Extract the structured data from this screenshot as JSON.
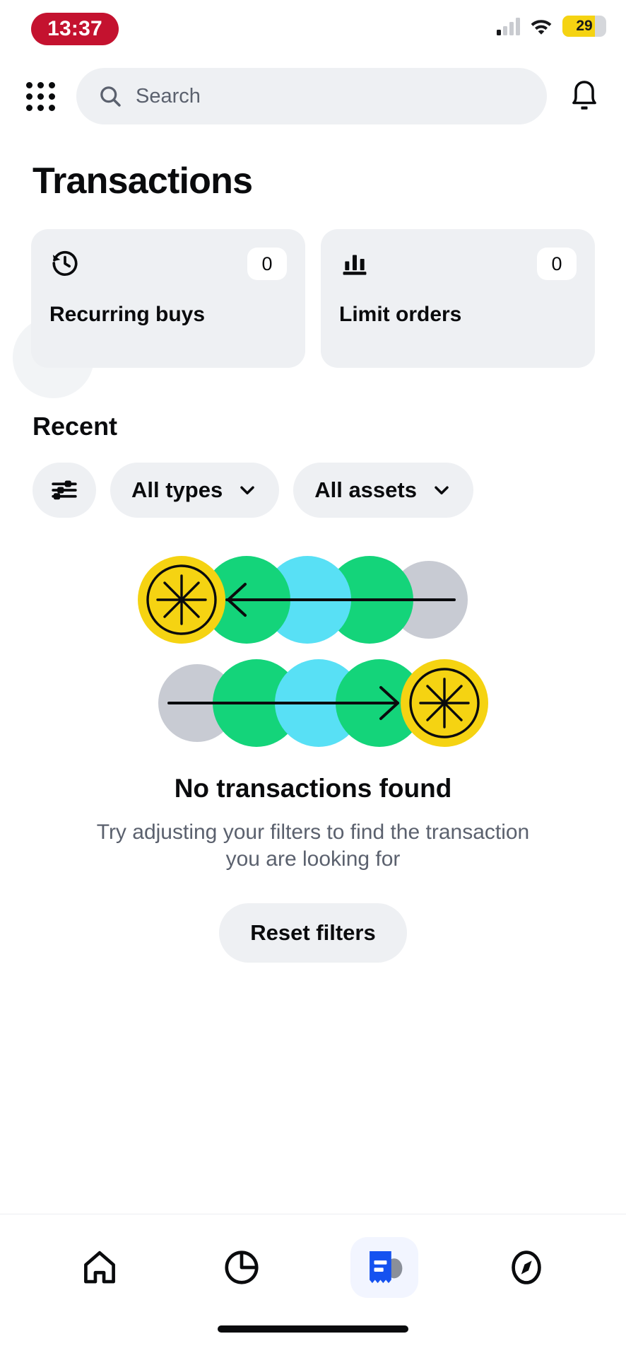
{
  "status_bar": {
    "time": "13:37",
    "time_pill_color": "#c4122f",
    "battery_level": "29",
    "battery_fill_color": "#f5d312",
    "signal_icon": "cellular-signal-icon",
    "wifi_icon": "wifi-icon"
  },
  "app_bar": {
    "grid_icon": "app-grid-icon",
    "search_placeholder": "Search",
    "search_icon": "search-icon",
    "notification_icon": "bell-icon"
  },
  "page": {
    "title": "Transactions",
    "section_title": "Recent"
  },
  "cards": [
    {
      "icon": "history-clock-icon",
      "count": "0",
      "label": "Recurring buys"
    },
    {
      "icon": "bar-chart-icon",
      "count": "0",
      "label": "Limit orders"
    }
  ],
  "filters": {
    "filter_icon": "sliders-filter-icon",
    "chips": [
      {
        "label": "All types",
        "icon": "chevron-down-icon"
      },
      {
        "label": "All assets",
        "icon": "chevron-down-icon"
      }
    ]
  },
  "empty_state": {
    "illustration": "transfer-arrows-circles-illustration",
    "title": "No transactions found",
    "subtitle": "Try adjusting your filters to find the transaction you are looking for",
    "reset_label": "Reset filters",
    "colors": {
      "yellow": "#f5d312",
      "green": "#14d47a",
      "cyan": "#58e0f5",
      "blue": "#1552f0",
      "gray": "#c8cbd3"
    }
  },
  "tab_bar": {
    "items": [
      {
        "name": "home",
        "icon": "home-icon",
        "active": false
      },
      {
        "name": "portfolio",
        "icon": "pie-chart-icon",
        "active": false
      },
      {
        "name": "transactions",
        "icon": "receipt-icon",
        "active": true
      },
      {
        "name": "explore",
        "icon": "compass-icon",
        "active": false
      }
    ],
    "active_color": "#1552f0"
  }
}
